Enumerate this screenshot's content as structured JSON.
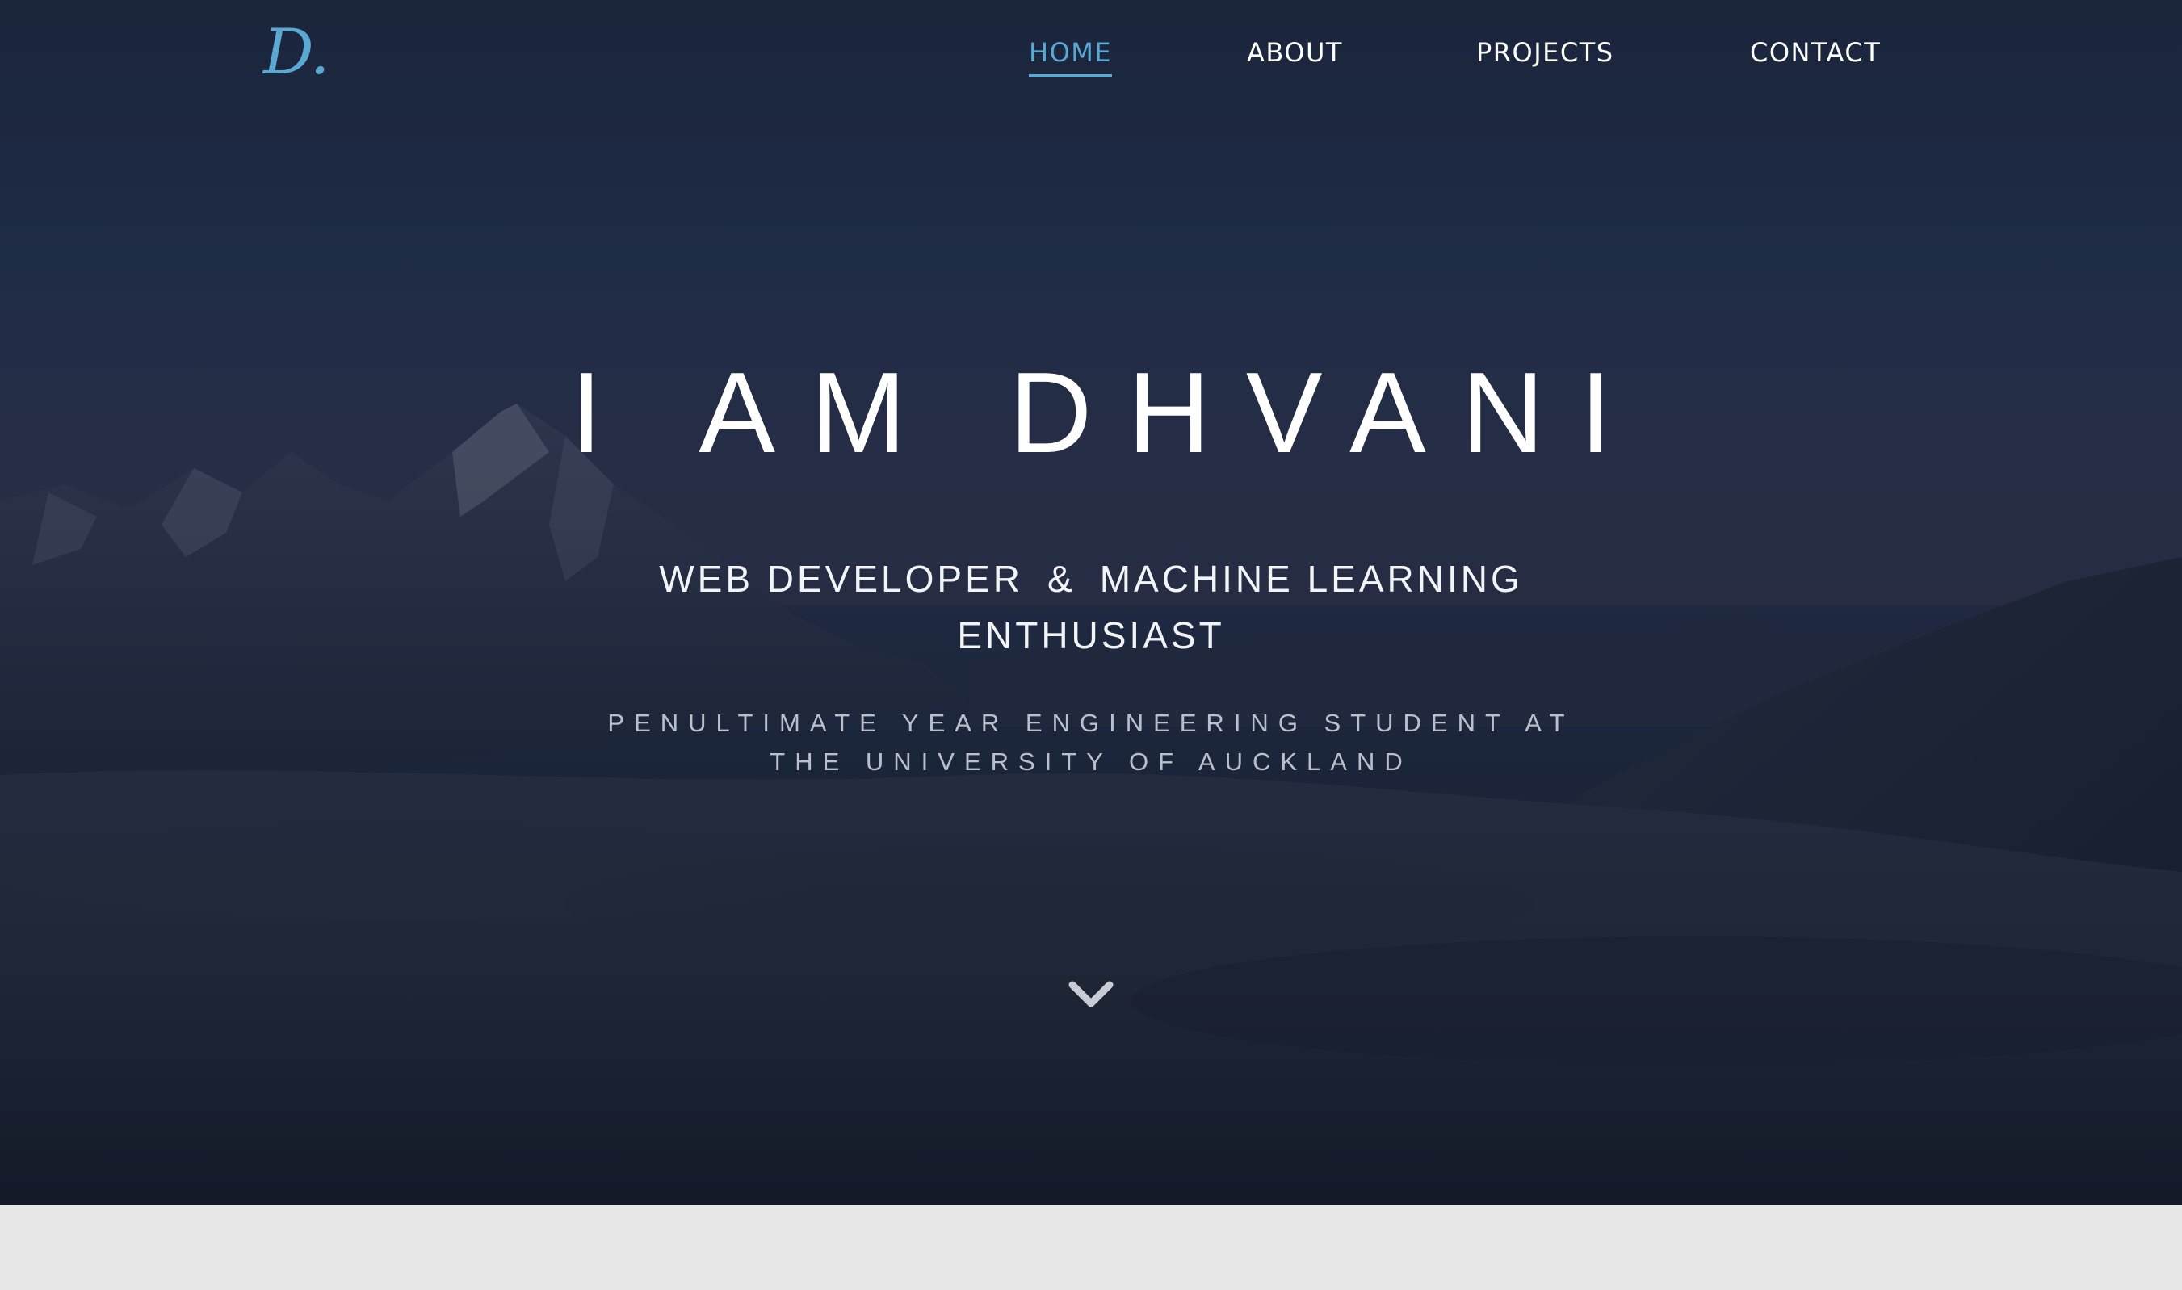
{
  "brand": {
    "logo_text": "D."
  },
  "nav": {
    "items": [
      {
        "label": "HOME",
        "active": true
      },
      {
        "label": "ABOUT",
        "active": false
      },
      {
        "label": "PROJECTS",
        "active": false
      },
      {
        "label": "CONTACT",
        "active": false
      }
    ]
  },
  "hero": {
    "title": "I AM DHVANI",
    "subtitle_left": "WEB DEVELOPER",
    "subtitle_amp": "&",
    "subtitle_right": "MACHINE LEARNING",
    "subtitle_line2": "ENTHUSIAST",
    "tagline_line1": "PENULTIMATE YEAR ENGINEERING STUDENT AT",
    "tagline_line2": "THE UNIVERSITY OF AUCKLAND",
    "scroll_icon": "chevron-down-icon"
  },
  "colors": {
    "accent": "#5ba8d2",
    "text": "#ffffff",
    "muted": "#b9c0cc",
    "band": "#e7e7e7"
  }
}
